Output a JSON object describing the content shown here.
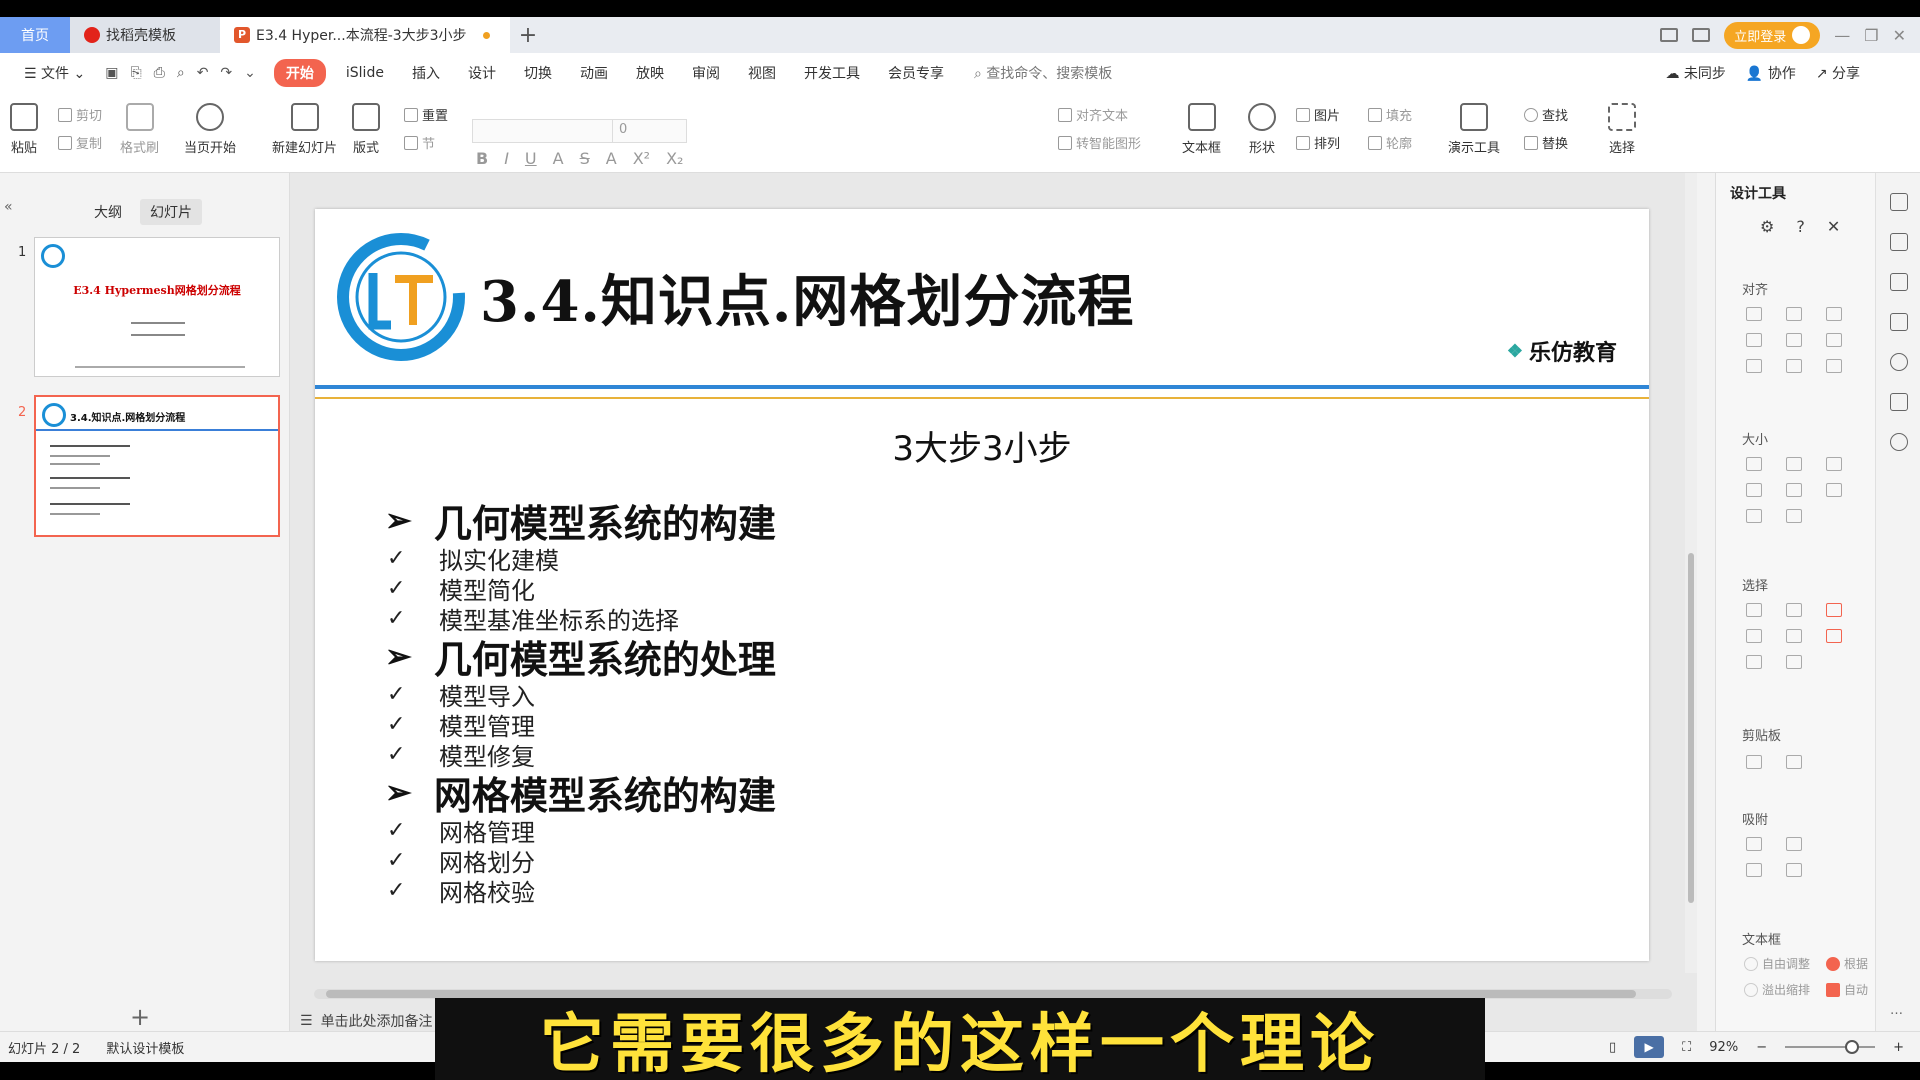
{
  "tabs": {
    "home": "首页",
    "template": "找稻壳模板",
    "document": "E3.4 Hyper...本流程-3大步3小步",
    "login": "立即登录"
  },
  "menu": {
    "file": "文件",
    "items": [
      "开始",
      "iSlide",
      "插入",
      "设计",
      "切换",
      "动画",
      "放映",
      "审阅",
      "视图",
      "开发工具",
      "会员专享"
    ],
    "search": "查找命令、搜索模板",
    "right": [
      "未同步",
      "协作",
      "分享"
    ]
  },
  "ribbon": {
    "paste": "粘贴",
    "cut": "剪切",
    "copy": "复制",
    "format_painter": "格式刷",
    "from_current": "当页开始",
    "new_slide": "新建幻灯片",
    "layout": "版式",
    "reset": "重置",
    "section": "节",
    "font_size": "0",
    "align_text": "对齐文本",
    "smart_art": "转智能图形",
    "textbox": "文本框",
    "shape": "形状",
    "picture": "图片",
    "arrange": "排列",
    "fill": "填充",
    "outline": "轮廓",
    "presenter_tools": "演示工具",
    "find": "查找",
    "replace": "替换",
    "select": "选择"
  },
  "left_panel": {
    "outline_tab": "大纲",
    "slides_tab": "幻灯片",
    "thumbs": [
      {
        "num": "1",
        "title": "E3.4 Hypermesh网格划分流程"
      },
      {
        "num": "2",
        "title": "3.4.知识点.网格划分流程"
      }
    ]
  },
  "slide": {
    "title": "3.4.知识点.网格划分流程",
    "brand": "乐仿教育",
    "subtitle": "3大步3小步",
    "sections": [
      {
        "heading": "几何模型系统的构建",
        "items": [
          "拟实化建模",
          "模型简化",
          "模型基准坐标系的选择"
        ]
      },
      {
        "heading": "几何模型系统的处理",
        "items": [
          "模型导入",
          "模型管理",
          "模型修复"
        ]
      },
      {
        "heading": "网格模型系统的构建",
        "items": [
          "网格管理",
          "网格划分",
          "网格校验"
        ]
      }
    ],
    "colors": {
      "rule_blue": "#2f86d6",
      "rule_gold": "#e8b23a",
      "logo_blue": "#1a8fd6",
      "logo_orange": "#f0a020"
    }
  },
  "notes_placeholder": "单击此处添加备注",
  "design_panel": {
    "title": "设计工具",
    "sections": [
      "对齐",
      "大小",
      "选择",
      "剪贴板",
      "吸附",
      "文本框"
    ],
    "checks": [
      "自由调整",
      "根据",
      "溢出缩排",
      "自动"
    ]
  },
  "status": {
    "slide_counter": "幻灯片 2 / 2",
    "template": "默认设计模板",
    "zoom": "92%"
  },
  "caption": "它需要很多的这样一个理论"
}
